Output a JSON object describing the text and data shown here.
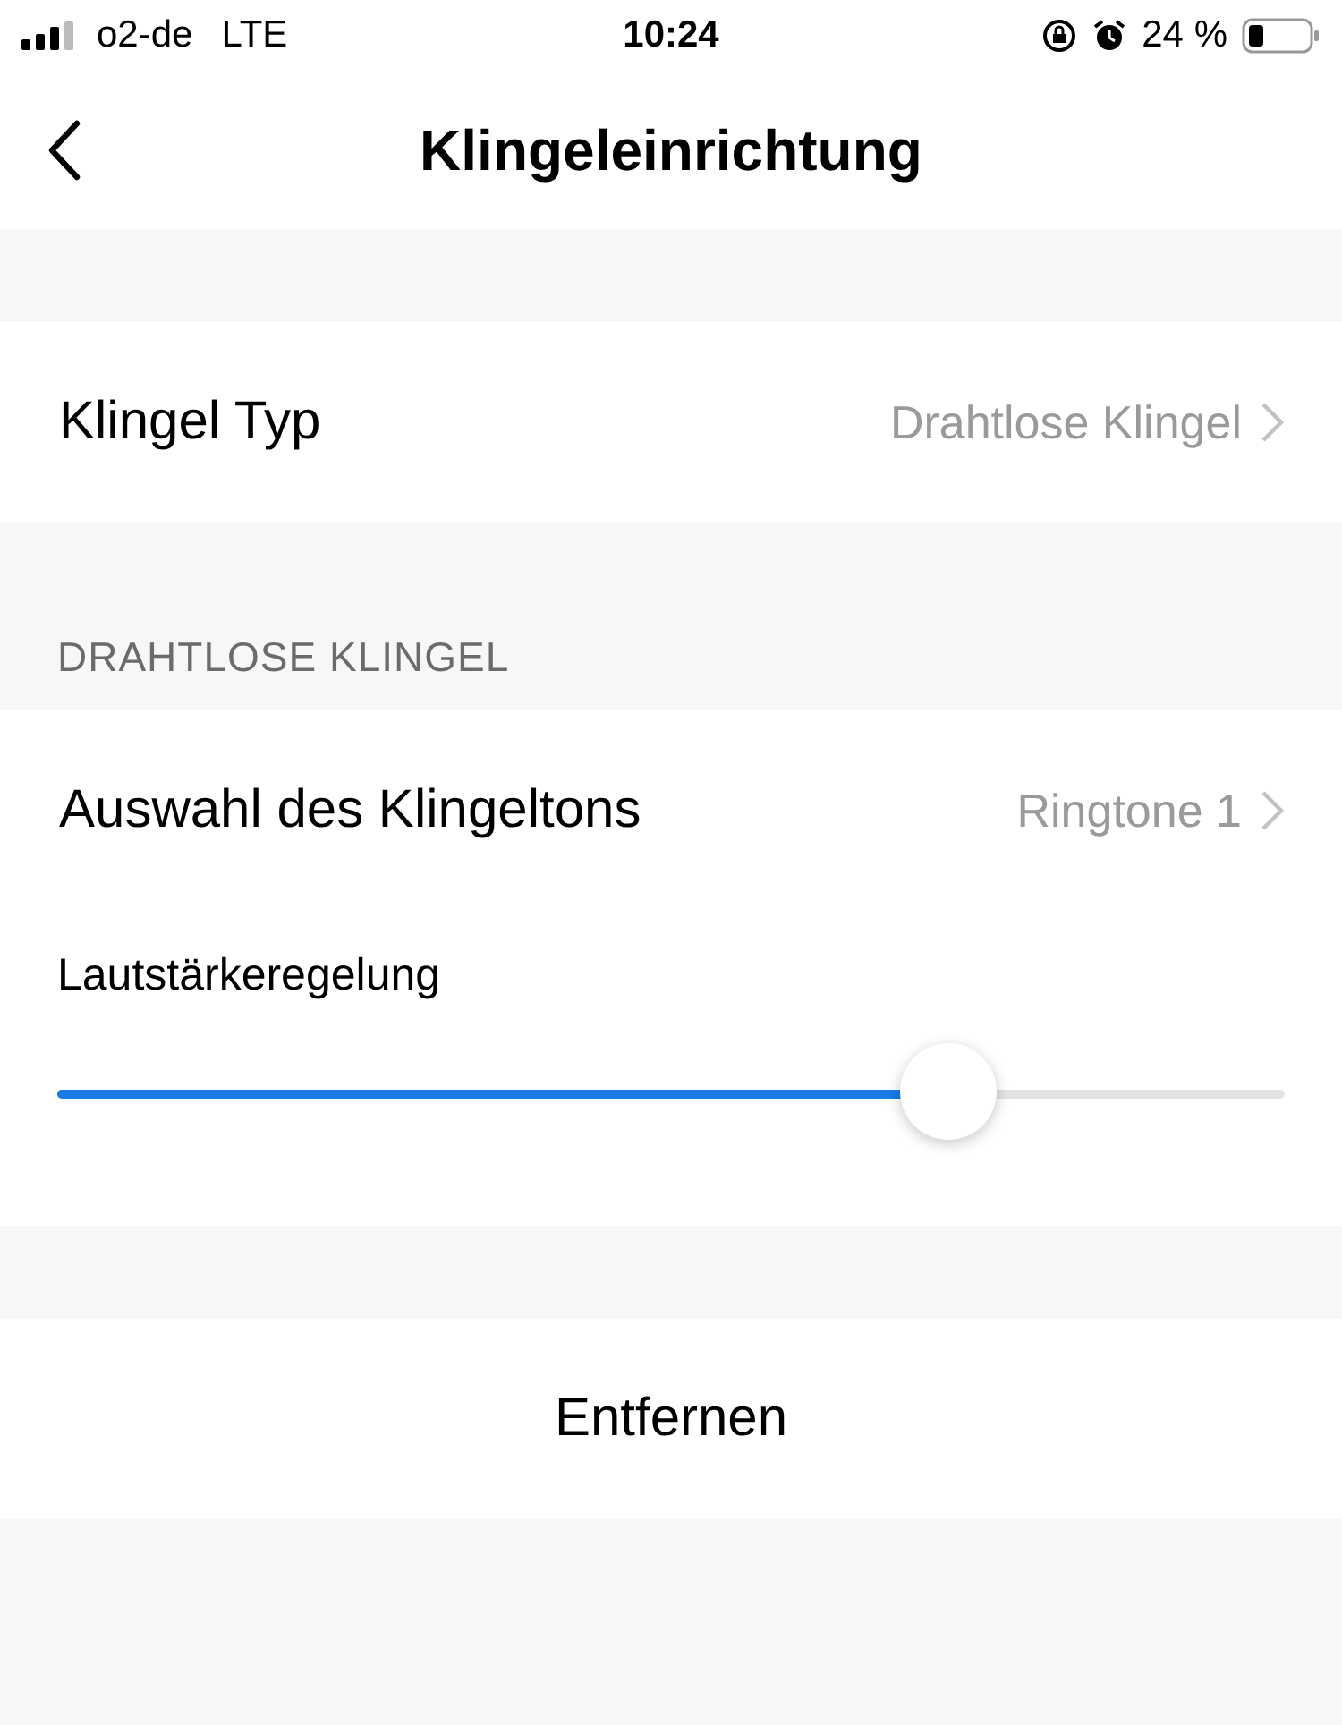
{
  "status_bar": {
    "carrier": "o2-de",
    "network": "LTE",
    "time": "10:24",
    "battery": "24 %"
  },
  "nav": {
    "title": "Klingeleinrichtung"
  },
  "bell_type": {
    "label": "Klingel Typ",
    "value": "Drahtlose Klingel"
  },
  "section_header": "DRAHTLOSE KLINGEL",
  "ringtone": {
    "label": "Auswahl des Klingeltons",
    "value": "Ringtone 1"
  },
  "volume": {
    "label": "Lautstärkeregelung",
    "level": 0.726
  },
  "remove_button": "Entfernen"
}
